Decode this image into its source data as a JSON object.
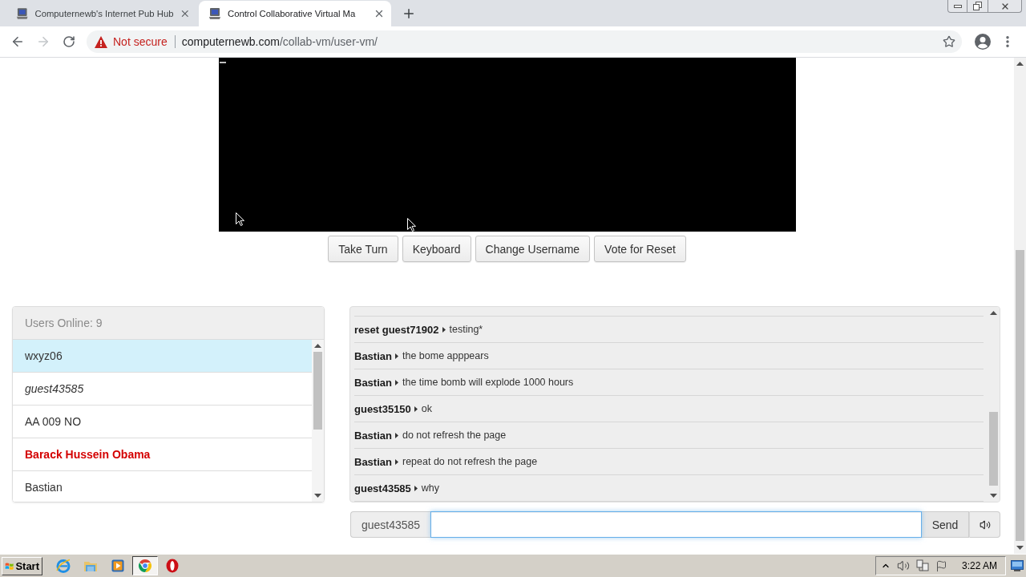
{
  "tabs": [
    {
      "title": "Computernewb's Internet Pub Hub",
      "selected": false
    },
    {
      "title": "Control Collaborative Virtual Ma",
      "selected": true
    }
  ],
  "nav": {
    "forward_disabled": true
  },
  "address_bar": {
    "security": "Not secure",
    "host": "computernewb.com",
    "path": "/collab-vm/user-vm/"
  },
  "vm_controls": [
    "Take Turn",
    "Keyboard",
    "Change Username",
    "Vote for Reset"
  ],
  "users": {
    "title": "Users Online: 9",
    "items": [
      {
        "name": "wxyz06",
        "kind": "user",
        "selected": true
      },
      {
        "name": "guest43585",
        "kind": "self",
        "selected": false
      },
      {
        "name": "AA 009 NO",
        "kind": "user",
        "selected": false
      },
      {
        "name": "Barack Hussein Obama",
        "kind": "admin",
        "selected": false
      },
      {
        "name": "Bastian",
        "kind": "user",
        "selected": false
      }
    ]
  },
  "chat": {
    "messages": [
      {
        "user": "reset guest71902",
        "text": "testing*"
      },
      {
        "user": "Bastian",
        "text": "the bome apppears"
      },
      {
        "user": "Bastian",
        "text": "the time bomb will explode 1000 hours"
      },
      {
        "user": "guest35150",
        "text": "ok"
      },
      {
        "user": "Bastian",
        "text": "do not refresh the page"
      },
      {
        "user": "Bastian",
        "text": "repeat do not refresh the page"
      },
      {
        "user": "guest43585",
        "text": "why"
      }
    ]
  },
  "chat_input": {
    "username": "guest43585",
    "focused": true,
    "send": "Send"
  },
  "taskbar": {
    "start": "Start",
    "apps": [
      {
        "kind": "explorer",
        "active": false
      },
      {
        "kind": "files",
        "active": false
      },
      {
        "kind": "player",
        "active": false
      },
      {
        "kind": "chrome",
        "active": true
      },
      {
        "kind": "opera",
        "active": false
      }
    ],
    "clock": "3:22 AM"
  }
}
